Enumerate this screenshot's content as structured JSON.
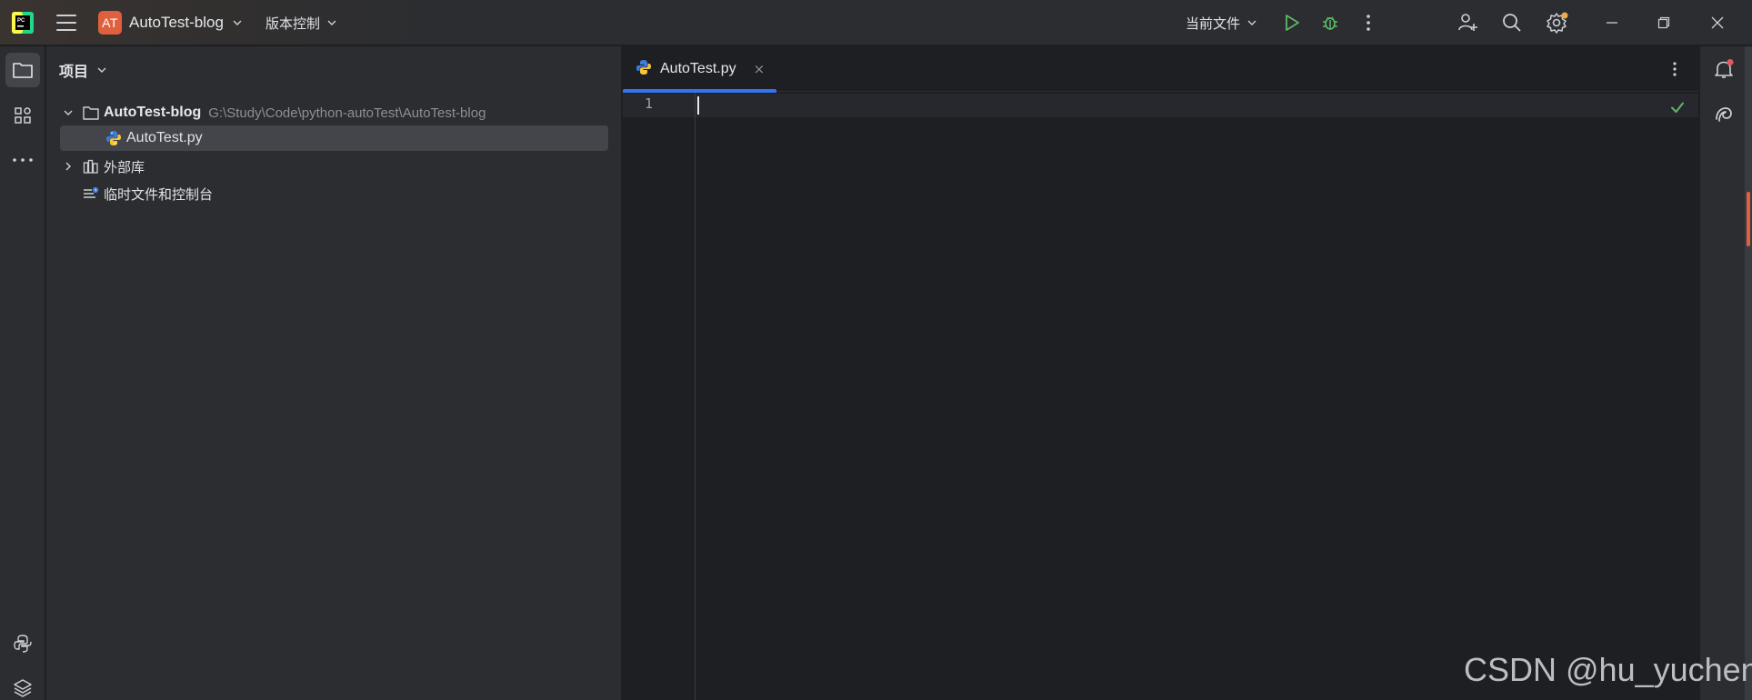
{
  "titlebar": {
    "project_badge": "AT",
    "project_name": "AutoTest-blog",
    "vcs_label": "版本控制",
    "run_config_label": "当前文件",
    "icons": [
      "pycharm-logo-icon",
      "hamburger-menu-icon",
      "run-icon",
      "debug-icon",
      "more-vertical-icon",
      "add-user-icon",
      "search-icon",
      "settings-icon",
      "minimize-icon",
      "restore-icon",
      "close-icon"
    ]
  },
  "left_strip": {
    "icons": [
      "project-folder-icon",
      "structure-icon",
      "more-horizontal-icon",
      "python-console-icon",
      "layers-icon"
    ]
  },
  "project_panel": {
    "title": "项目",
    "tree": {
      "root_name": "AutoTest-blog",
      "root_path": "G:\\Study\\Code\\python-autoTest\\AutoTest-blog",
      "file_name": "AutoTest.py",
      "external_libs": "外部库",
      "scratches": "临时文件和控制台"
    }
  },
  "editor": {
    "tab_label": "AutoTest.py",
    "tab_close": "×",
    "line_number": "1"
  },
  "right_strip": {
    "icons": [
      "notifications-icon",
      "ai-assistant-icon"
    ]
  },
  "watermark": "CSDN @hu_yuchen",
  "colors": {
    "accent": "#3574f0",
    "project_badge": "#e0603e",
    "run_green": "#5fb865",
    "notification_dot": "#e55765"
  }
}
